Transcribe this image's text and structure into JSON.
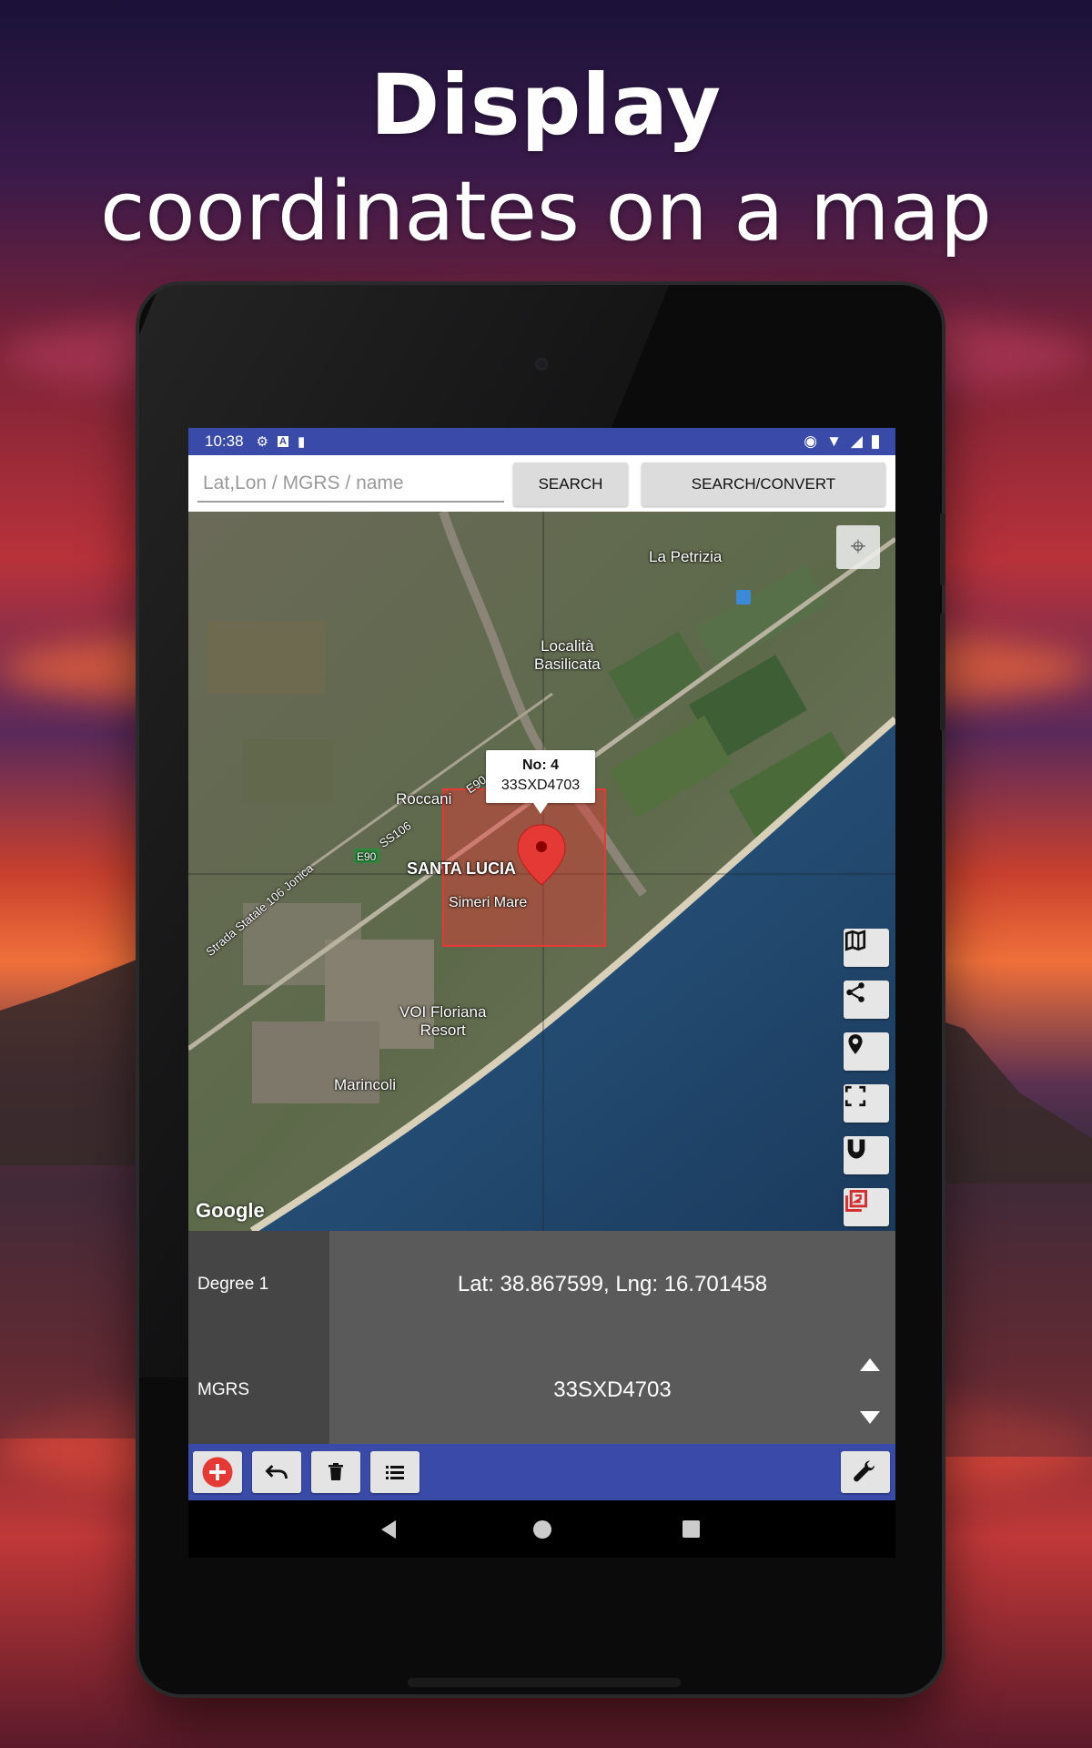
{
  "headline": {
    "line1": "Display",
    "line2": "coordinates on a map"
  },
  "status_bar": {
    "time": "10:38",
    "icons_left": [
      "settings-icon",
      "a-icon",
      "sd-card-icon"
    ],
    "icons_right": [
      "location-icon",
      "wifi-icon",
      "signal-icon",
      "battery-icon"
    ]
  },
  "search": {
    "placeholder": "Lat,Lon / MGRS / name",
    "value": "",
    "search_label": "SEARCH",
    "convert_label": "SEARCH/CONVERT"
  },
  "map": {
    "places": {
      "la_petrizia": "La Petrizia",
      "localita_basilicata": "Località\nBasilicata",
      "roccani": "Roccani",
      "santa_lucia": "SANTA LUCIA",
      "simeri_mare": "Simeri Mare",
      "voi_floriana": "VOI Floriana\nResort",
      "marincoli": "Marincoli",
      "e90_a": "E90",
      "e90_b": "E90",
      "ss106": "SS106",
      "strada_statale": "Strada Statale 106 Jonica"
    },
    "attribution": "Google",
    "marker": {
      "number": "No: 4",
      "mgrs": "33SXD4703"
    },
    "tools": [
      "map-type-icon",
      "share-icon",
      "place-marker-icon",
      "fullscreen-icon",
      "magnet-icon",
      "layers-icon"
    ]
  },
  "info_panel": {
    "rows": [
      {
        "label": "Degree 1",
        "value": "Lat: 38.867599, Lng: 16.701458"
      },
      {
        "label": "MGRS",
        "value": "33SXD4703"
      }
    ]
  },
  "toolbar": {
    "buttons": [
      "add-icon",
      "undo-icon",
      "delete-icon",
      "list-icon"
    ],
    "settings": "wrench-icon"
  },
  "colors": {
    "primary": "#3a4aa8",
    "marker": "#e53935",
    "panel": "#5a5a5a",
    "panel_label": "#454545"
  }
}
